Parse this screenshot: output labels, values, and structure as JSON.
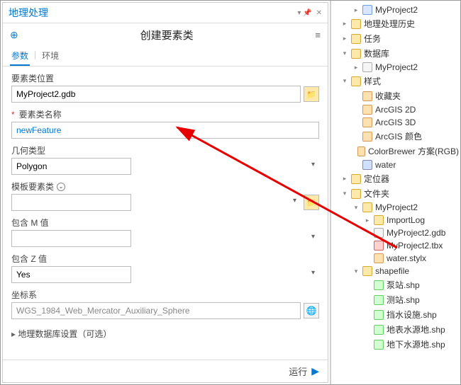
{
  "panel": {
    "title": "地理处理",
    "tool_title": "创建要素类",
    "tabs": {
      "params": "参数",
      "env": "环境"
    }
  },
  "fields": {
    "location": {
      "label": "要素类位置",
      "value": "MyProject2.gdb"
    },
    "name": {
      "label": "要素类名称",
      "value": "newFeature"
    },
    "geom": {
      "label": "几何类型",
      "value": "Polygon"
    },
    "template": {
      "label": "模板要素类",
      "value": ""
    },
    "m": {
      "label": "包含 M 值",
      "value": ""
    },
    "z": {
      "label": "包含 Z 值",
      "value": "Yes"
    },
    "sr": {
      "label": "坐标系",
      "value": "WGS_1984_Web_Mercator_Auxiliary_Sphere"
    },
    "gdb_settings": "地理数据库设置（可选）"
  },
  "footer": {
    "run": "运行"
  },
  "tree": [
    {
      "depth": 1,
      "toggle": "▸",
      "icon": "proj",
      "label": "MyProject2"
    },
    {
      "depth": 0,
      "toggle": "▸",
      "icon": "folder",
      "label": "地理处理历史"
    },
    {
      "depth": 0,
      "toggle": "▸",
      "icon": "folder",
      "label": "任务"
    },
    {
      "depth": 0,
      "toggle": "▾",
      "icon": "folder",
      "label": "数据库"
    },
    {
      "depth": 1,
      "toggle": "▸",
      "icon": "db",
      "label": "MyProject2"
    },
    {
      "depth": 0,
      "toggle": "▾",
      "icon": "folder",
      "label": "样式"
    },
    {
      "depth": 1,
      "toggle": "",
      "icon": "style",
      "label": "收藏夹"
    },
    {
      "depth": 1,
      "toggle": "",
      "icon": "style",
      "label": "ArcGIS 2D"
    },
    {
      "depth": 1,
      "toggle": "",
      "icon": "style",
      "label": "ArcGIS 3D"
    },
    {
      "depth": 1,
      "toggle": "",
      "icon": "style",
      "label": "ArcGIS 颜色"
    },
    {
      "depth": 1,
      "toggle": "",
      "icon": "style",
      "label": "ColorBrewer 方案(RGB)"
    },
    {
      "depth": 1,
      "toggle": "",
      "icon": "water",
      "label": "water"
    },
    {
      "depth": 0,
      "toggle": "▸",
      "icon": "folder",
      "label": "定位器"
    },
    {
      "depth": 0,
      "toggle": "▾",
      "icon": "folder",
      "label": "文件夹"
    },
    {
      "depth": 1,
      "toggle": "▾",
      "icon": "folder-open",
      "label": "MyProject2"
    },
    {
      "depth": 2,
      "toggle": "▸",
      "icon": "folder",
      "label": "ImportLog"
    },
    {
      "depth": 2,
      "toggle": "",
      "icon": "db",
      "label": "MyProject2.gdb"
    },
    {
      "depth": 2,
      "toggle": "",
      "icon": "tbx",
      "label": "MyProject2.tbx"
    },
    {
      "depth": 2,
      "toggle": "",
      "icon": "style",
      "label": "water.stylx"
    },
    {
      "depth": 1,
      "toggle": "▾",
      "icon": "folder-open",
      "label": "shapefile"
    },
    {
      "depth": 2,
      "toggle": "",
      "icon": "shp",
      "label": "泵站.shp"
    },
    {
      "depth": 2,
      "toggle": "",
      "icon": "shp",
      "label": "测站.shp"
    },
    {
      "depth": 2,
      "toggle": "",
      "icon": "shp",
      "label": "挡水设施.shp"
    },
    {
      "depth": 2,
      "toggle": "",
      "icon": "shp",
      "label": "地表水源地.shp"
    },
    {
      "depth": 2,
      "toggle": "",
      "icon": "shp",
      "label": "地下水源地.shp"
    }
  ]
}
